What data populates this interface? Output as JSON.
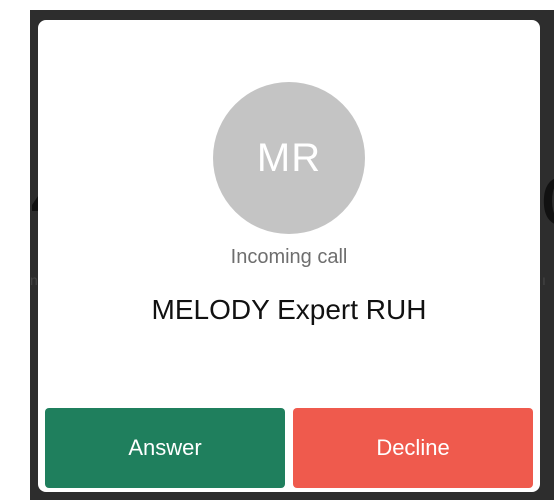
{
  "incoming_call": {
    "avatar_initials": "MR",
    "status_text": "Incoming call",
    "caller_name": "MELODY Expert RUH",
    "answer_label": "Answer",
    "decline_label": "Decline"
  },
  "colors": {
    "answer": "#1f7f5d",
    "decline": "#ef5a4d",
    "avatar_bg": "#c4c4c4",
    "backdrop": "#2d2d2d"
  }
}
